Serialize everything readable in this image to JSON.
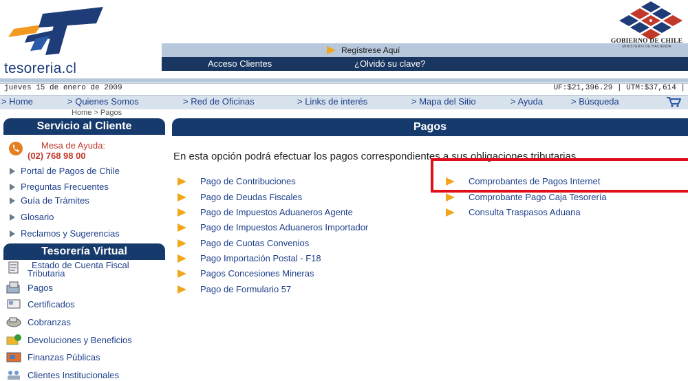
{
  "header": {
    "brand": "tesoreria.cl",
    "register_link": "Regístrese Aquí",
    "access_clients": "Acceso Clientes",
    "forgot_password": "¿Olvidó su clave?",
    "gov_title": "GOBIERNO DE CHILE",
    "gov_subtitle": "MINISTERIO DE HACIENDA"
  },
  "infobar": {
    "date": "jueves 15 de enero de 2009",
    "indicators": "UF:$21,396.29 | UTM:$37,614 |"
  },
  "nav": {
    "items": [
      "> Home",
      "> Quienes Somos",
      "> Red de Oficinas",
      "> Links de interés",
      "> Mapa del Sitio",
      "> Ayuda",
      "> Búsqueda"
    ],
    "breadcrumb": "Home > Pagos"
  },
  "sidebar": {
    "service_title": "Servicio al Cliente",
    "help_title": "Mesa de Ayuda:",
    "help_phone": "(02) 768 98 00",
    "service_items": [
      "Portal de Pagos de Chile",
      "Preguntas Frecuentes",
      "Guía de Trámites",
      "Glosario",
      "Reclamos y Sugerencias"
    ],
    "virtual_title": "Tesorería Virtual",
    "virtual_items": [
      {
        "label": "Estado de Cuenta Fiscal",
        "label2": "Tributaria",
        "icon": "document-icon"
      },
      {
        "label": "Pagos",
        "icon": "payments-icon"
      },
      {
        "label": "Certificados",
        "icon": "certificate-icon"
      },
      {
        "label": "Cobranzas",
        "icon": "collections-icon"
      },
      {
        "label": "Devoluciones y Beneficios",
        "icon": "refunds-icon"
      },
      {
        "label": "Finanzas Públicas",
        "icon": "finance-icon"
      },
      {
        "label": "Clientes Institucionales",
        "icon": "institution-icon"
      }
    ]
  },
  "main": {
    "title": "Pagos",
    "intro": "En esta opción podrá efectuar los pagos correspondientes a sus obligaciones tributarias.",
    "payments_left": [
      "Pago de Contribuciones",
      "Pago de Deudas Fiscales",
      "Pago de Impuestos Aduaneros Agente",
      "Pago de Impuestos Aduaneros Importador",
      "Pago de Cuotas Convenios",
      "Pago Importación Postal - F18",
      "Pagos Concesiones Mineras",
      "Pago de Formulario 57"
    ],
    "payments_right": [
      "Comprobantes de Pagos Internet",
      "Comprobante Pago Caja Tesorería",
      "Consulta Traspasos Aduana"
    ]
  },
  "colors": {
    "navy": "#163a6b",
    "arrow": "#f0a71e",
    "highlight": "#e0101a",
    "link": "#1d3f8a"
  }
}
